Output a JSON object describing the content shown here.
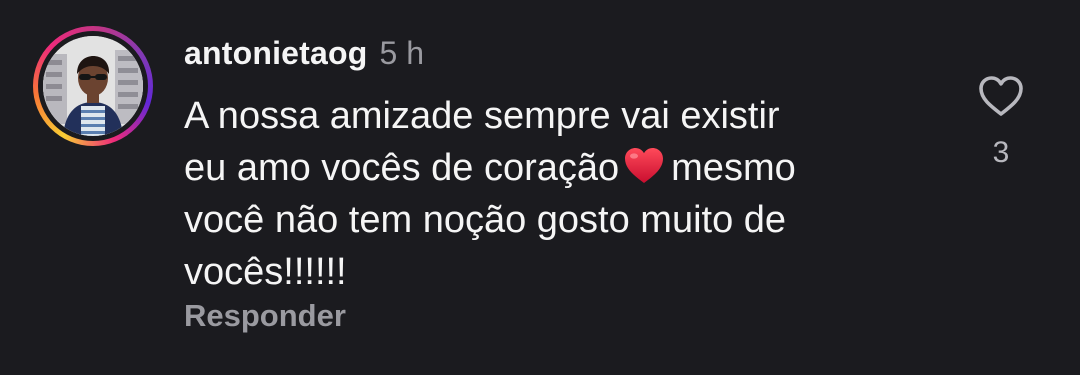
{
  "comment": {
    "username": "antonietaog",
    "timestamp": "5 h",
    "text_lines": [
      "A nossa amizade sempre vai existir",
      "eu amo vocês de coração",
      "mesmo",
      "você não tem noção gosto muito de",
      "vocês!!!!!!"
    ],
    "emoji": "red-heart",
    "reply_label": "Responder",
    "like_count": "3",
    "like_icon": "heart-outline-icon"
  },
  "colors": {
    "background": "#1b1b1f",
    "primary_text": "#f5f5f5",
    "secondary_text": "#9a9aa0",
    "heart_emoji": "#e3193b"
  }
}
